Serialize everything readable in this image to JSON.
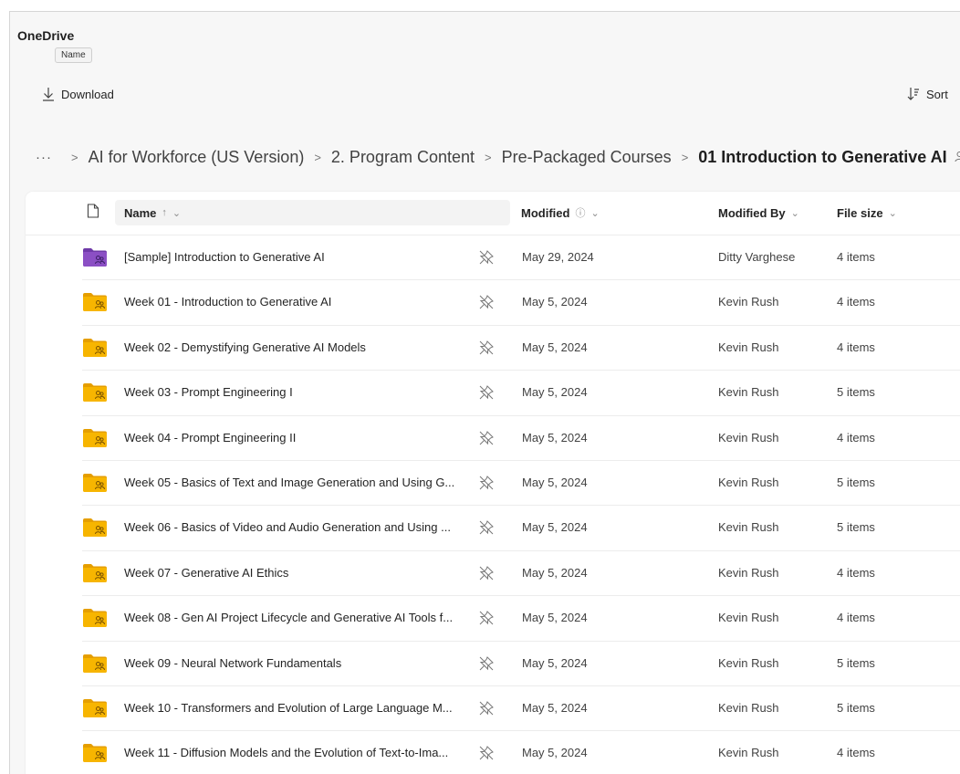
{
  "app": {
    "title": "OneDrive",
    "tooltip": "Name"
  },
  "commands": {
    "download": "Download",
    "sort": "Sort"
  },
  "breadcrumb": {
    "more": "···",
    "items": [
      "AI for Workforce (US Version)",
      "2. Program Content",
      "Pre-Packaged Courses"
    ],
    "current": "01 Introduction to Generative AI"
  },
  "columns": {
    "name": "Name",
    "name_sort": "↑",
    "modified": "Modified",
    "modified_by": "Modified By",
    "file_size": "File size"
  },
  "colors": {
    "folder_yellow": "#f7b500",
    "folder_purple": "#8b4fc4",
    "accent": "#242424"
  },
  "rows": [
    {
      "name": "[Sample] Introduction to Generative AI",
      "modified": "May 29, 2024",
      "modified_by": "Ditty Varghese",
      "size": "4 items",
      "folder": "purple"
    },
    {
      "name": "Week 01 - Introduction to Generative AI",
      "modified": "May 5, 2024",
      "modified_by": "Kevin Rush",
      "size": "4 items",
      "folder": "yellow"
    },
    {
      "name": "Week 02 - Demystifying Generative AI Models",
      "modified": "May 5, 2024",
      "modified_by": "Kevin Rush",
      "size": "4 items",
      "folder": "yellow"
    },
    {
      "name": "Week 03 - Prompt Engineering I",
      "modified": "May 5, 2024",
      "modified_by": "Kevin Rush",
      "size": "5 items",
      "folder": "yellow"
    },
    {
      "name": "Week 04 - Prompt Engineering II",
      "modified": "May 5, 2024",
      "modified_by": "Kevin Rush",
      "size": "4 items",
      "folder": "yellow"
    },
    {
      "name": "Week 05 - Basics of Text and Image Generation and Using G...",
      "modified": "May 5, 2024",
      "modified_by": "Kevin Rush",
      "size": "5 items",
      "folder": "yellow"
    },
    {
      "name": "Week 06 - Basics of Video and Audio Generation and Using ...",
      "modified": "May 5, 2024",
      "modified_by": "Kevin Rush",
      "size": "5 items",
      "folder": "yellow"
    },
    {
      "name": "Week 07 - Generative AI Ethics",
      "modified": "May 5, 2024",
      "modified_by": "Kevin Rush",
      "size": "4 items",
      "folder": "yellow"
    },
    {
      "name": "Week 08 - Gen AI Project Lifecycle and Generative AI Tools f...",
      "modified": "May 5, 2024",
      "modified_by": "Kevin Rush",
      "size": "4 items",
      "folder": "yellow"
    },
    {
      "name": "Week 09 - Neural Network Fundamentals",
      "modified": "May 5, 2024",
      "modified_by": "Kevin Rush",
      "size": "5 items",
      "folder": "yellow"
    },
    {
      "name": "Week 10 - Transformers and Evolution of Large Language M...",
      "modified": "May 5, 2024",
      "modified_by": "Kevin Rush",
      "size": "5 items",
      "folder": "yellow"
    },
    {
      "name": "Week 11 - Diffusion Models and the Evolution of Text-to-Ima...",
      "modified": "May 5, 2024",
      "modified_by": "Kevin Rush",
      "size": "4 items",
      "folder": "yellow"
    }
  ]
}
